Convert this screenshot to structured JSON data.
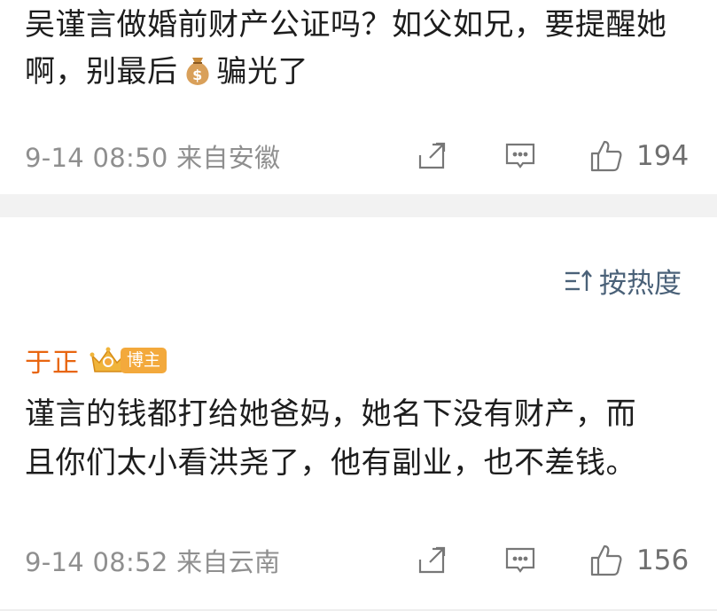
{
  "post": {
    "text_part1": "吴谨言做婚前财产公证吗？如父如兄，要提醒她啊，别最后",
    "text_part2": "骗光了",
    "emoji": "money-bag-icon",
    "meta": "9-14 08:50 来自安徽",
    "like_count": "194"
  },
  "sort": {
    "label": "按热度"
  },
  "comment": {
    "author": "于正",
    "badge": "博主",
    "text": "谨言的钱都打给她爸妈，她名下没有财产，而且你们太小看洪尧了，他有副业，也不差钱。",
    "meta": "9-14 08:52 来自云南",
    "like_count": "156"
  },
  "colors": {
    "author": "#e8650f",
    "badge": "#f3a93c",
    "sort": "#4a6178",
    "meta": "#8f8f8f",
    "gap": "#f2f2f2"
  }
}
